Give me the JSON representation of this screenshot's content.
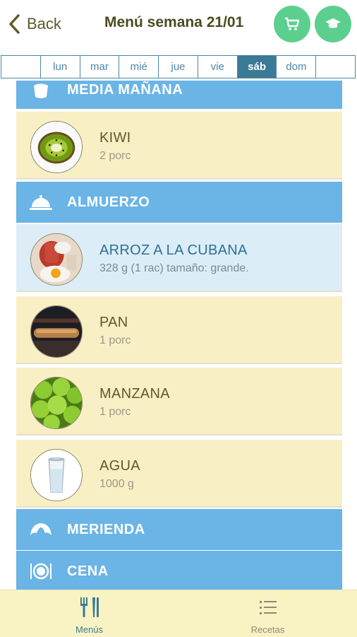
{
  "header": {
    "back_label": "Back",
    "title": "Menú semana 21/01",
    "accent_color": "#5ccf8e"
  },
  "days": [
    {
      "label": ""
    },
    {
      "label": "lun"
    },
    {
      "label": "mar"
    },
    {
      "label": "mié"
    },
    {
      "label": "jue"
    },
    {
      "label": "vie"
    },
    {
      "label": "sáb",
      "active": true
    },
    {
      "label": "dom"
    },
    {
      "label": ""
    }
  ],
  "sections": {
    "media_manana": {
      "label": "MEDIA MAÑANA",
      "icon": "fruit-bowl-icon"
    },
    "almuerzo": {
      "label": "ALMUERZO",
      "icon": "cloche-icon"
    },
    "merienda": {
      "label": "MERIENDA",
      "icon": "croissant-icon"
    },
    "cena": {
      "label": "CENA",
      "icon": "plate-cutlery-icon"
    }
  },
  "items": {
    "kiwi": {
      "name": "KIWI",
      "qty": "2 porc",
      "image": "kiwi"
    },
    "arroz": {
      "name": "ARROZ A LA CUBANA",
      "qty": "328 g (1 rac) tamaño: grande.",
      "image": "arroz-a-la-cubana"
    },
    "pan": {
      "name": "PAN",
      "qty": "1 porc",
      "image": "pan"
    },
    "manzana": {
      "name": "MANZANA",
      "qty": "1 porc",
      "image": "manzana"
    },
    "agua": {
      "name": "AGUA",
      "qty": "1000 g",
      "image": "agua"
    }
  },
  "bottom_nav": {
    "menus": {
      "label": "Menús",
      "icon": "cutlery-icon"
    },
    "recetas": {
      "label": "Recetas",
      "icon": "list-icon"
    }
  },
  "colors": {
    "section_bg": "#6bb4e6",
    "item_bg": "#f9efc5",
    "highlight_bg": "#dcedf8",
    "tab_active": "#3b7a96"
  }
}
